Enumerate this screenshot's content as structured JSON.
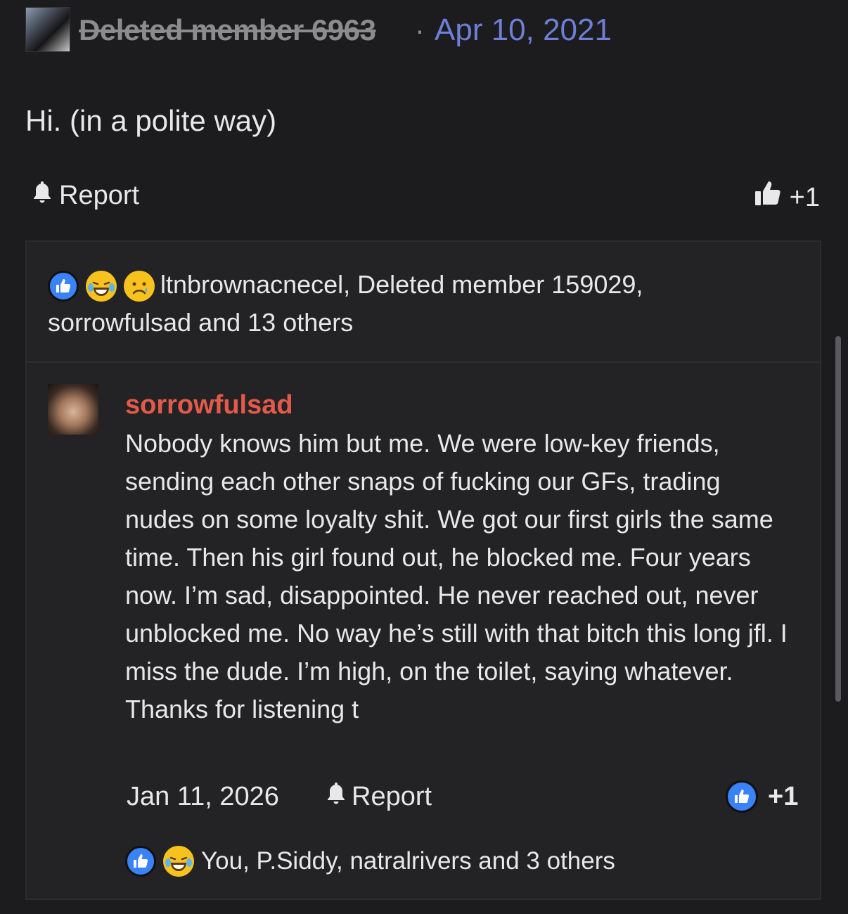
{
  "post": {
    "author": "Deleted member 6963",
    "separator": "·",
    "date": "Apr 10, 2021",
    "body": "Hi. (in a polite way)",
    "report_label": "Report",
    "like_count": "+1"
  },
  "reactions_summary": {
    "line1": "ltnbrownacnecel, Deleted member 159029,",
    "line2": "sorrowfulsad and 13 others",
    "icons": [
      "like-icon",
      "laughing-crying-icon",
      "sad-icon"
    ]
  },
  "reply": {
    "author": "sorrowfulsad",
    "text": "Nobody knows him but me. We were low-key friends, sending each other snaps of fucking our GFs, trading nudes on some loyalty shit. We got our first girls the same time. Then his girl found out, he blocked me. Four years now. I’m sad, disappointed. He never reached out, never unblocked me. No way he’s still with that bitch this long jfl. I miss the dude. I’m high, on the toilet, saying whatever. Thanks for listening t",
    "date": "Jan 11, 2026",
    "report_label": "Report",
    "like_count": "+1",
    "reactions": "You, P.Siddy, natralrivers and 3 others"
  },
  "colors": {
    "background": "#1c1c1e",
    "panel": "#232325",
    "link_blue": "#6d7fd6",
    "author_red": "#e35a4a",
    "like_blue": "#3a82f7"
  }
}
